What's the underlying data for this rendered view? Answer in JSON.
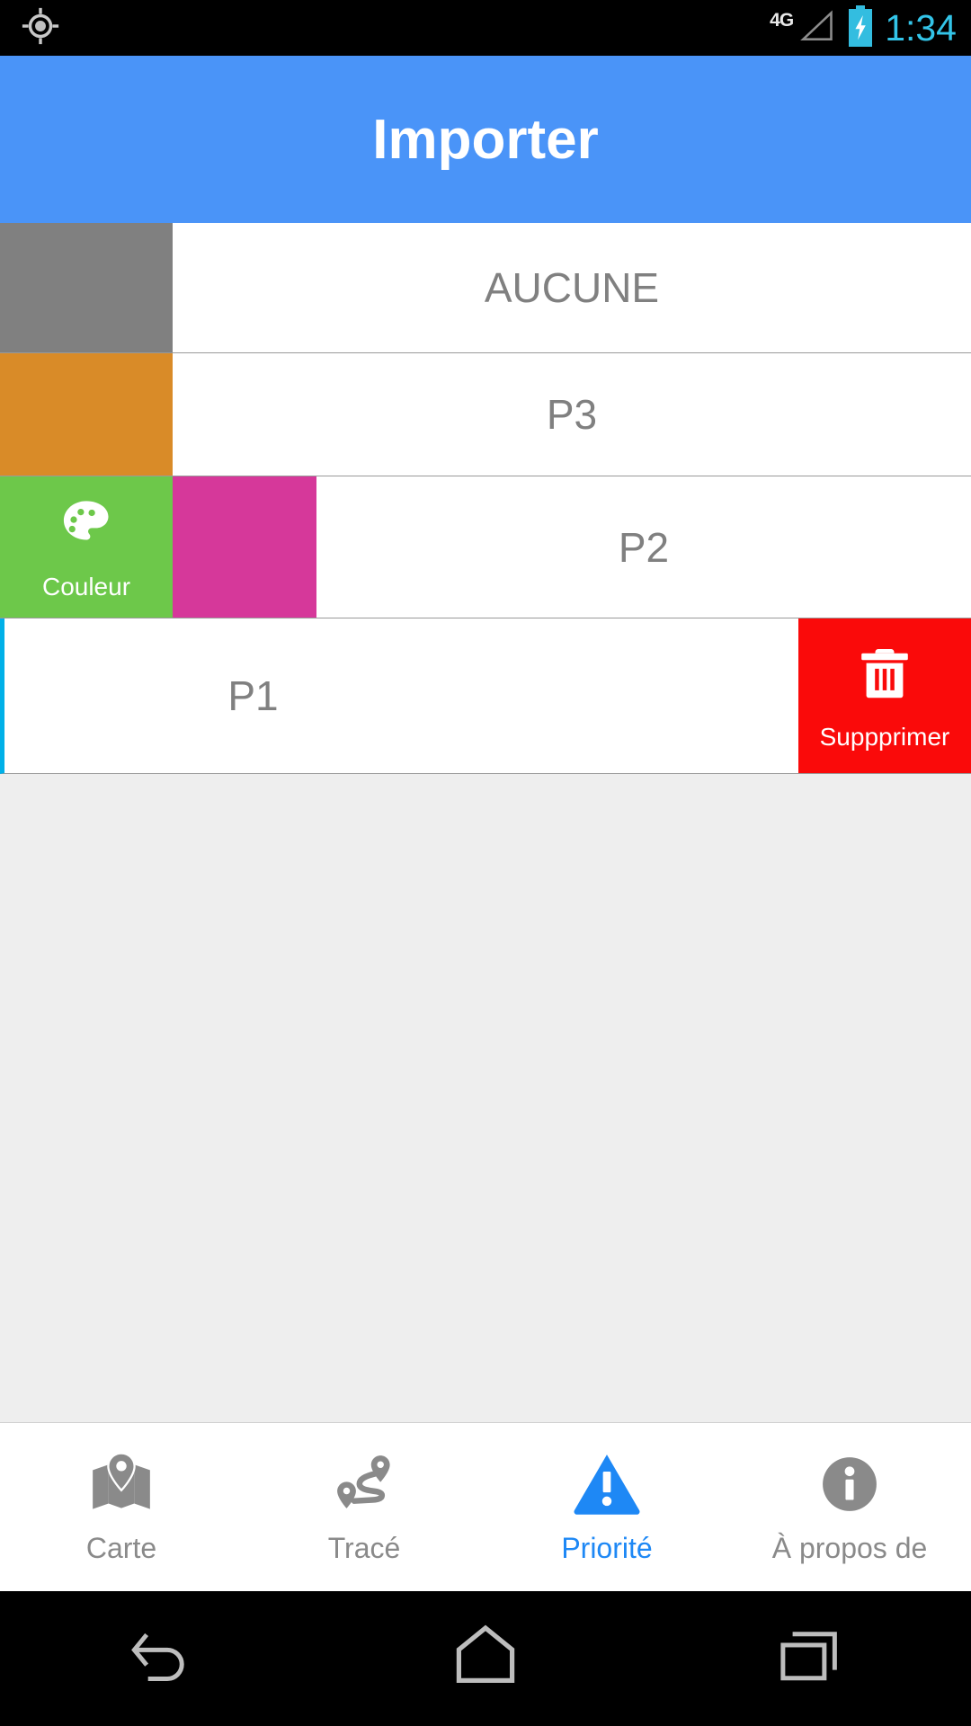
{
  "status_bar": {
    "gps_icon": "gps-fixed-icon",
    "network_label": "4G",
    "signal_icon": "signal-triangle-icon",
    "battery_icon": "battery-charging-icon",
    "time": "1:34",
    "time_color": "#33c4e8",
    "background": "#000000"
  },
  "app_bar": {
    "title": "Importer",
    "background": "#4a94f8",
    "text_color": "#ffffff"
  },
  "list": {
    "rows": [
      {
        "label": "AUCUNE",
        "swatch_color": "#808080",
        "state": "default"
      },
      {
        "label": "P3",
        "swatch_color": "#d98b28",
        "state": "default"
      },
      {
        "label": "P2",
        "swatch_color": "#d6389a",
        "state": "swiped-right",
        "action": {
          "label": "Couleur",
          "icon": "palette-icon",
          "background": "#6dc84a",
          "text_color": "#ffffff"
        }
      },
      {
        "label": "P1",
        "swatch_color": "#00b0e8",
        "state": "swiped-left",
        "action": {
          "label": "Suppprimer",
          "icon": "trash-icon",
          "background": "#fa0a0a",
          "text_color": "#ffffff"
        }
      }
    ],
    "row_text_color": "#808080",
    "background": "#ffffff",
    "empty_area_color": "#eeeeee"
  },
  "tab_bar": {
    "active_color": "#1e88f5",
    "inactive_color": "#8a8a8a",
    "background": "#ffffff",
    "tabs": [
      {
        "label": "Carte",
        "icon": "map-icon",
        "active": false
      },
      {
        "label": "Tracé",
        "icon": "route-icon",
        "active": false
      },
      {
        "label": "Priorité",
        "icon": "warning-triangle-icon",
        "active": true
      },
      {
        "label": "À propos de",
        "icon": "info-circle-icon",
        "active": false
      }
    ]
  },
  "nav_bar": {
    "background": "#000000",
    "buttons": [
      {
        "name": "back",
        "icon": "back-arrow-icon"
      },
      {
        "name": "home",
        "icon": "home-icon"
      },
      {
        "name": "recents",
        "icon": "recents-icon"
      }
    ]
  }
}
